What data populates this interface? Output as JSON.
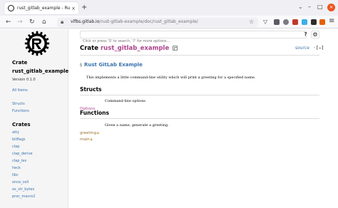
{
  "browser": {
    "tab_title": "rust_gitlab_example - Rust",
    "tab_close": "×",
    "new_tab": "+",
    "tab_list": "⌄",
    "url_host": "vlfbs.gitlab.io",
    "url_path": "/rust-gitlab-example/doc/rust_gitlab_example/",
    "window_min": "–",
    "window_max": "□",
    "window_close": "×"
  },
  "sidebar": {
    "crate_title": "Crate rust_gitlab_example",
    "version": "Version 0.1.0",
    "all_items": "All Items",
    "nav_items": [
      "Structs",
      "Functions"
    ],
    "crates_heading": "Crates",
    "crates": [
      "atty",
      "bitflags",
      "clap",
      "clap_derive",
      "clap_lex",
      "heck",
      "libc",
      "once_cell",
      "os_str_bytes",
      "proc_macro2"
    ]
  },
  "search": {
    "placeholder": "Click or press 'S' to search, '?' for more options...",
    "help_label": "?",
    "settings_label": "⚙"
  },
  "main": {
    "heading_prefix": "Crate ",
    "crate_name": "rust_gitlab_example",
    "source_label": "source",
    "collapse_label": "· [−]",
    "doc_heading": "Rust GitLab Example",
    "doc_anchor": "§",
    "description": "This implements a little command-line utility which will print a greeting for a specified name.",
    "structs_heading": "Structs",
    "structs": [
      {
        "name": "Options",
        "desc": "Command-line options"
      }
    ],
    "functions_heading": "Functions",
    "functions": [
      {
        "name": "greeting",
        "desc": "Given a name, generate a greeting."
      },
      {
        "name": "main",
        "desc": ""
      }
    ]
  }
}
